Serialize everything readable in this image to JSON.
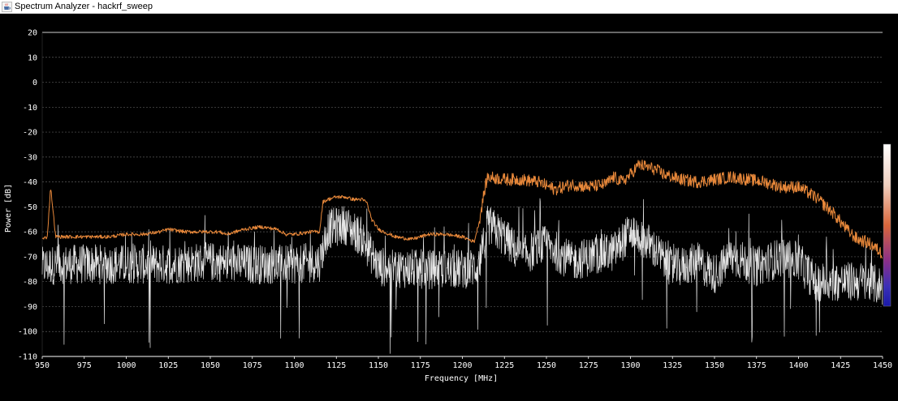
{
  "window": {
    "title": "Spectrum Analyzer - hackrf_sweep",
    "icon": "java-coffee-cup-icon"
  },
  "chart_data": {
    "type": "line",
    "title": "",
    "xlabel": "Frequency [MHz]",
    "ylabel": "Power [dB]",
    "xlim": [
      950,
      1450
    ],
    "ylim": [
      -110,
      20
    ],
    "x_ticks": [
      950,
      975,
      1000,
      1025,
      1050,
      1075,
      1100,
      1125,
      1150,
      1175,
      1200,
      1225,
      1250,
      1275,
      1300,
      1325,
      1350,
      1375,
      1400,
      1425,
      1450
    ],
    "y_ticks": [
      20,
      10,
      0,
      -10,
      -20,
      -30,
      -40,
      -50,
      -60,
      -70,
      -80,
      -90,
      -100,
      -110
    ],
    "grid": "horizontal dashed",
    "background": "#000000",
    "colors": {
      "peak_hold": "#e8883a",
      "live": "#e6e6e6",
      "grid": "#5a5a5a",
      "axis": "#ffffff",
      "colorbar_top": "#ffffff",
      "colorbar_mid": "#d9663a",
      "colorbar_low": "#6a2fa8",
      "colorbar_bottom": "#1a1aa8"
    },
    "series": [
      {
        "name": "",
        "color": "#e8883a",
        "x": [
          950,
          953,
          955,
          958,
          965,
          975,
          990,
          1000,
          1010,
          1020,
          1025,
          1035,
          1045,
          1055,
          1060,
          1070,
          1080,
          1090,
          1095,
          1100,
          1110,
          1115,
          1117,
          1120,
          1125,
          1130,
          1135,
          1140,
          1143,
          1146,
          1150,
          1160,
          1170,
          1175,
          1180,
          1190,
          1200,
          1207,
          1210,
          1213,
          1215,
          1225,
          1235,
          1245,
          1255,
          1265,
          1275,
          1285,
          1290,
          1295,
          1300,
          1305,
          1310,
          1315,
          1320,
          1330,
          1340,
          1350,
          1360,
          1370,
          1380,
          1390,
          1400,
          1405,
          1410,
          1415,
          1420,
          1425,
          1430,
          1435,
          1440,
          1445,
          1450
        ],
        "y": [
          -63,
          -62,
          -42,
          -62,
          -62,
          -62,
          -62,
          -61,
          -61,
          -60,
          -59,
          -60,
          -60,
          -60,
          -61,
          -59,
          -58,
          -59,
          -61,
          -61,
          -60,
          -60,
          -48,
          -47,
          -46,
          -46,
          -47,
          -47,
          -48,
          -55,
          -59,
          -62,
          -63,
          -62,
          -61,
          -61,
          -62,
          -64,
          -56,
          -44,
          -38,
          -39,
          -39,
          -40,
          -43,
          -41,
          -42,
          -41,
          -38,
          -40,
          -37,
          -33,
          -34,
          -35,
          -37,
          -39,
          -40,
          -39,
          -38,
          -39,
          -40,
          -42,
          -42,
          -44,
          -46,
          -49,
          -52,
          -56,
          -60,
          -63,
          -64,
          -66,
          -69
        ]
      },
      {
        "name": "",
        "color": "#e6e6e6",
        "x": [
          950,
          960,
          975,
          1000,
          1025,
          1050,
          1075,
          1100,
          1115,
          1120,
          1130,
          1140,
          1145,
          1150,
          1175,
          1200,
          1210,
          1215,
          1225,
          1235,
          1250,
          1265,
          1275,
          1290,
          1300,
          1310,
          1325,
          1340,
          1350,
          1360,
          1375,
          1390,
          1400,
          1410,
          1425,
          1440,
          1450
        ],
        "y": [
          -74,
          -73,
          -73,
          -73,
          -73,
          -72,
          -73,
          -73,
          -72,
          -59,
          -57,
          -62,
          -68,
          -74,
          -75,
          -75,
          -74,
          -57,
          -62,
          -70,
          -65,
          -72,
          -70,
          -68,
          -60,
          -64,
          -75,
          -72,
          -77,
          -70,
          -74,
          -70,
          -72,
          -80,
          -80,
          -80,
          -82
        ]
      }
    ]
  }
}
